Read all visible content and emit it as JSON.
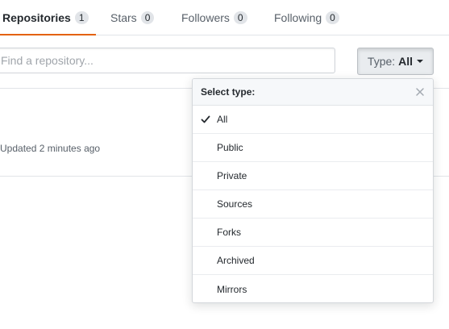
{
  "tabs": [
    {
      "label": "Repositories",
      "count": "1",
      "selected": true
    },
    {
      "label": "Stars",
      "count": "0",
      "selected": false
    },
    {
      "label": "Followers",
      "count": "0",
      "selected": false
    },
    {
      "label": "Following",
      "count": "0",
      "selected": false
    }
  ],
  "search": {
    "placeholder": "Find a repository..."
  },
  "type_filter": {
    "prefix": "Type:",
    "value": "All"
  },
  "repo": {
    "updated_text": "Updated 2 minutes ago"
  },
  "type_menu": {
    "title": "Select type:",
    "selected_index": 0,
    "options": [
      "All",
      "Public",
      "Private",
      "Sources",
      "Forks",
      "Archived",
      "Mirrors"
    ]
  },
  "colors": {
    "accent_underline": "#e36209",
    "counter_bg": "#e1e4e8",
    "border": "#e1e4e8"
  },
  "icons": {
    "selected_option": "check-icon",
    "menu_close": "close-icon",
    "dropdown": "caret-down-icon"
  }
}
